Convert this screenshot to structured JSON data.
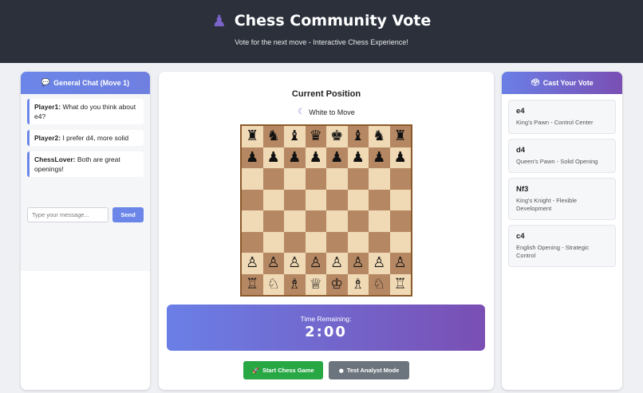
{
  "header": {
    "icon": "pawn-icon",
    "title": "Chess Community Vote",
    "subtitle": "Vote for the next move - Interactive Chess Experience!"
  },
  "chat": {
    "title": "General Chat (Move 1)",
    "icon": "chat-bubble-icon",
    "messages": [
      {
        "user": "Player1:",
        "text": " What do you think about e4?"
      },
      {
        "user": "Player2:",
        "text": " I prefer d4, more solid"
      },
      {
        "user": "ChessLover:",
        "text": " Both are great openings!"
      }
    ],
    "input_placeholder": "Type your message...",
    "send_label": "Send"
  },
  "board_panel": {
    "title": "Current Position",
    "to_move": "White to Move",
    "to_move_icon": "moon-icon",
    "board": [
      [
        "♜",
        "♞",
        "♝",
        "♛",
        "♚",
        "♝",
        "♞",
        "♜"
      ],
      [
        "♟",
        "♟",
        "♟",
        "♟",
        "♟",
        "♟",
        "♟",
        "♟"
      ],
      [
        "",
        "",
        "",
        "",
        "",
        "",
        "",
        ""
      ],
      [
        "",
        "",
        "",
        "",
        "",
        "",
        "",
        ""
      ],
      [
        "",
        "",
        "",
        "",
        "",
        "",
        "",
        ""
      ],
      [
        "",
        "",
        "",
        "",
        "",
        "",
        "",
        ""
      ],
      [
        "♙",
        "♙",
        "♙",
        "♙",
        "♙",
        "♙",
        "♙",
        "♙"
      ],
      [
        "♖",
        "♘",
        "♗",
        "♕",
        "♔",
        "♗",
        "♘",
        "♖"
      ]
    ],
    "timer_label": "Time Remaining:",
    "timer_value": "2:00",
    "start_button": "Start Chess Game",
    "start_icon": "rocket-icon",
    "analyst_button": "Test Analyst Mode",
    "analyst_icon": "brain-icon"
  },
  "vote": {
    "title": "Cast Your Vote",
    "icon": "ballot-box-icon",
    "options": [
      {
        "move": "e4",
        "desc": "King's Pawn - Control Center"
      },
      {
        "move": "d4",
        "desc": "Queen's Pawn - Solid Opening"
      },
      {
        "move": "Nf3",
        "desc": "King's Knight - Flexible Development"
      },
      {
        "move": "c4",
        "desc": "English Opening - Strategic Control"
      }
    ]
  },
  "colors": {
    "header_bg": "#2b303b",
    "accent": "#6b86e8",
    "gradient_end": "#7a4fb4",
    "board_light": "#f0d9b5",
    "board_dark": "#b58863",
    "start_green": "#28a745",
    "analyst_gray": "#6c757d"
  }
}
